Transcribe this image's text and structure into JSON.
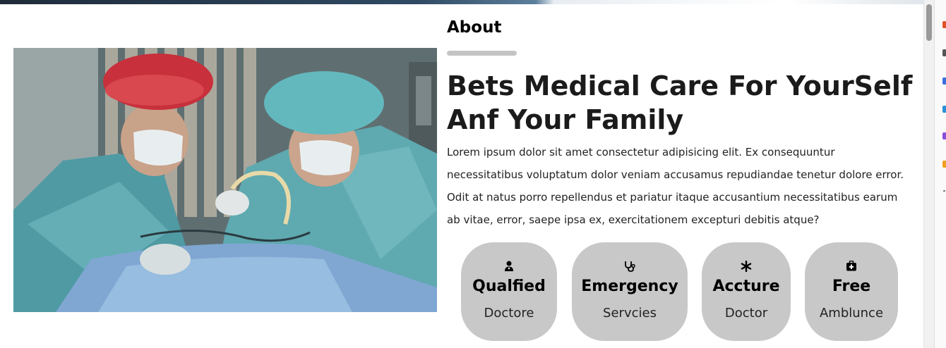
{
  "about": {
    "heading": "About",
    "headline": "Bets Medical Care For YourSelf Anf Your Family",
    "paragraph": "Lorem ipsum dolor sit amet consectetur adipisicing elit. Ex consequuntur necessitatibus voluptatum dolor veniam accusamus repudiandae tenetur dolore error. Odit at natus porro repellendus et pariatur itaque accusantium necessitatibus earum ab vitae, error, saepe ipsa ex, exercitationem excepturi debitis atque?"
  },
  "features": [
    {
      "icon": "doctor-icon",
      "title": "Qualfied",
      "subtitle": "Doctore"
    },
    {
      "icon": "stethoscope-icon",
      "title": "Emergency",
      "subtitle": "Servcies"
    },
    {
      "icon": "asterisk-icon",
      "title": "Accture",
      "subtitle": "Doctor"
    },
    {
      "icon": "first-aid-kit-icon",
      "title": "Free",
      "subtitle": "Amblunce"
    }
  ],
  "colors": {
    "feature_bg": "#c8c8c8",
    "underline": "#c4c4c4",
    "text": "#1b1b1b"
  }
}
